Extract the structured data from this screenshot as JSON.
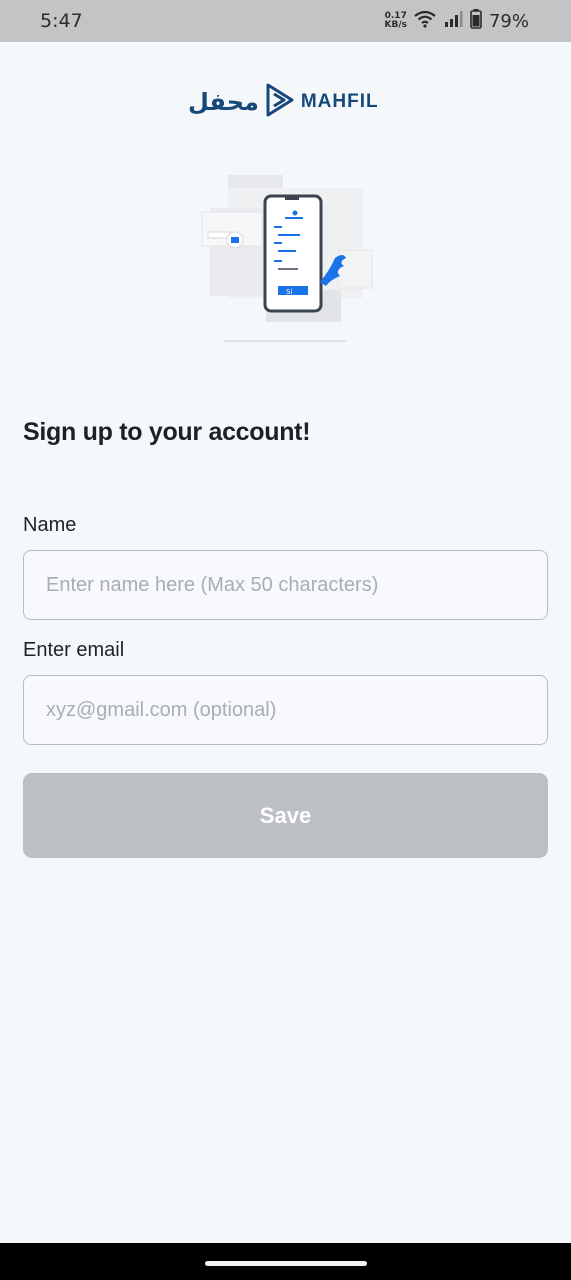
{
  "status_bar": {
    "time": "5:47",
    "net_speed_value": "0.17",
    "net_speed_unit": "KB/s",
    "battery": "79%",
    "icons": [
      "wifi-icon",
      "signal-icon",
      "battery-icon"
    ]
  },
  "logo": {
    "arabic": "محفل",
    "english": "MAHFIL",
    "color": "#16497a"
  },
  "illustration": {
    "button_text": "Si",
    "icon": "signup-phone-illustration",
    "accent": "#1a73e8"
  },
  "form": {
    "heading": "Sign up to your account!",
    "name_label": "Name",
    "name_placeholder": "Enter name here (Max 50 characters)",
    "name_value": "",
    "email_label": "Enter email",
    "email_placeholder": "xyz@gmail.com (optional)",
    "email_value": "",
    "save_label": "Save",
    "save_color": "#bcbfc3"
  }
}
